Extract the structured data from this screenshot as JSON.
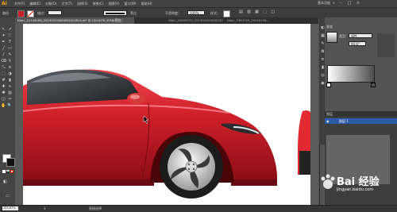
{
  "app": {
    "logo": "Ai",
    "menus": [
      "文件(F)",
      "编辑(E)",
      "对象(O)",
      "文字(T)",
      "选择(S)",
      "效果(C)",
      "视图(V)",
      "窗口(W)",
      "帮助(H)"
    ],
    "workspace": "基本功能",
    "window_controls": [
      "–",
      "□",
      "×"
    ]
  },
  "control_bar": {
    "object_label": "路径",
    "stroke_label": "描边:",
    "stroke_style_label": "等比",
    "opacity_label": "不透明度:",
    "opacity_value": "100%",
    "style_label": "样式:"
  },
  "document_tabs": [
    {
      "label": "Nipic_22149169_20190203081652415814.ai* @ 150.67% (RGB/预览)",
      "active": true
    },
    {
      "label": "Nipic_19909272_20190200182815216...",
      "active": false
    },
    {
      "label": "Nipic_7363799_20190198...",
      "active": false
    }
  ],
  "panels": {
    "gradient_tab": "渐变",
    "type_label": "类型:",
    "type_value": "线性",
    "angle_value": "90.6°",
    "layers_tab": "图层",
    "layer_name": "图层 1"
  },
  "status": {
    "zoom": "150.67%",
    "page": "1",
    "tool": "直接选择"
  },
  "watermark": {
    "text": "Bai 经验",
    "url": "jingyan.baidu.com"
  },
  "colors": {
    "car_red": "#d0202a",
    "car_dark": "#8a0d14",
    "tire": "#1c1c1c",
    "rim": "#d9d9d9",
    "accent": "#f7a500"
  },
  "tool_icons": [
    "selection-icon",
    "direct-selection-icon",
    "magic-wand-icon",
    "lasso-icon",
    "pen-icon",
    "type-icon",
    "line-icon",
    "rectangle-icon",
    "brush-icon",
    "pencil-icon",
    "eraser-icon",
    "rotate-icon",
    "scale-icon",
    "width-icon",
    "free-transform-icon",
    "shape-builder-icon",
    "mesh-icon",
    "gradient-icon",
    "eyedropper-icon",
    "blend-icon",
    "symbol-sprayer-icon",
    "graph-icon",
    "artboard-icon",
    "slice-icon",
    "hand-icon",
    "zoom-icon"
  ]
}
